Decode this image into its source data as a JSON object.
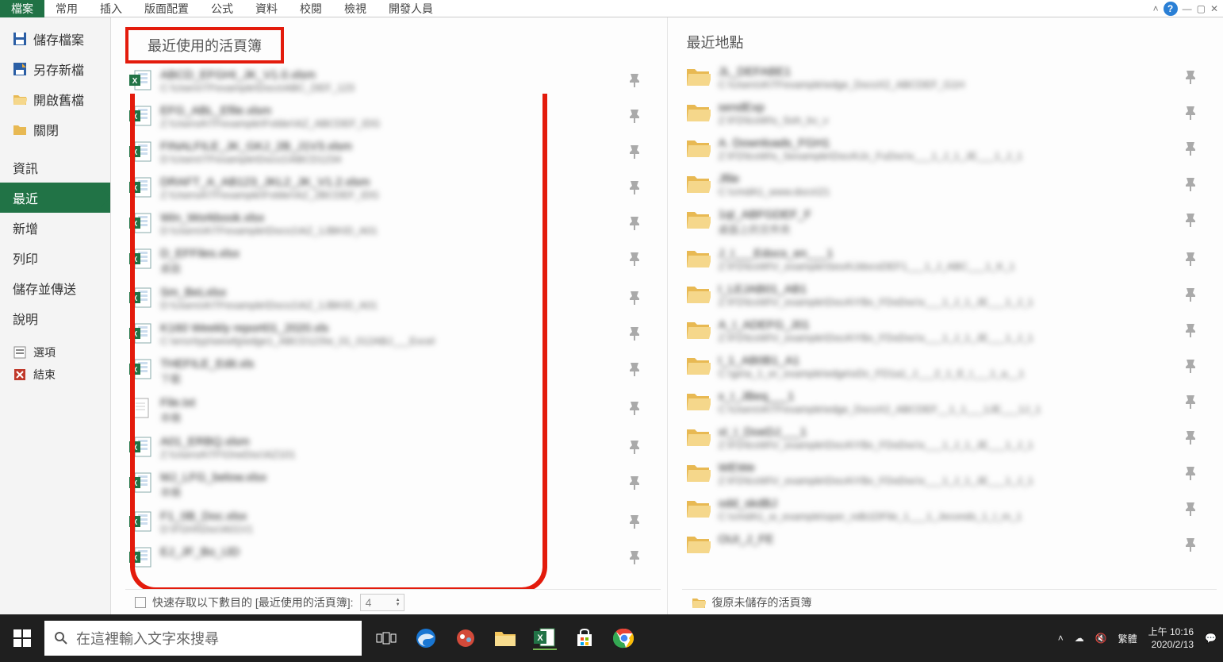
{
  "ribbon": {
    "tabs": [
      "檔案",
      "常用",
      "插入",
      "版面配置",
      "公式",
      "資料",
      "校閱",
      "檢視",
      "開發人員"
    ],
    "active_index": 0
  },
  "sidebar": {
    "items": [
      {
        "label": "儲存檔案",
        "icon": "save"
      },
      {
        "label": "另存新檔",
        "icon": "save-as"
      },
      {
        "label": "開啟舊檔",
        "icon": "open"
      },
      {
        "label": "關閉",
        "icon": "close-folder"
      }
    ],
    "items2": [
      {
        "label": "資訊"
      },
      {
        "label": "最近",
        "selected": true
      },
      {
        "label": "新增"
      },
      {
        "label": "列印"
      },
      {
        "label": "儲存並傳送"
      },
      {
        "label": "說明"
      }
    ],
    "items3": [
      {
        "label": "選項",
        "icon": "options"
      },
      {
        "label": "結束",
        "icon": "exit"
      }
    ]
  },
  "recent_workbooks": {
    "header": "最近使用的活頁簿",
    "items": [
      {
        "name": "ABCD_EFGHI_JK_V1.0.xlsm",
        "path": "C:\\Users\\TFexample\\Docs\\ABC_DEF_123"
      },
      {
        "name": "EFG_ABL_Efile.xlsm",
        "path": "Z:\\UsersA\\TFexample\\Folder\\AZ_ABCDEF_IDG"
      },
      {
        "name": "FINALFILE_JK_GKJ_2B_J1V3.xlsm",
        "path": "D:\\Users\\TFexample\\Docs1\\ABCD1234"
      },
      {
        "name": "DRAFT_A_AB123_JKL2_JK_V1.2.xlsm",
        "path": "Z:\\UsersA\\TFexample\\Folder\\AZ_2BCDEF_IDG"
      },
      {
        "name": "Win_Workbook.xlsx",
        "path": "D:\\Users\\A\\TFexample\\Docs1\\AZ_1JBKID_A01"
      },
      {
        "name": "D_EFFiles.xlsx",
        "path": "桌面"
      },
      {
        "name": "Sm_BeLxlsx",
        "path": "D:\\Users\\A\\TFexample\\Docs1\\AZ_1JBKID_A01"
      },
      {
        "name": "K160 Weekly report01_2020.xls",
        "path": "C:\\ersx\\typ\\wewfg\\edge1_ABCD123\\e_01_012ABJ___Excel"
      },
      {
        "name": "THEFILE_Edit.xls",
        "path": "下載"
      },
      {
        "name": "File.txt",
        "path": "本機",
        "txt": true
      },
      {
        "name": "A01_ERBQ.xlsm",
        "path": "Z:\\UsersA\\TF\\OneDoc\\AZ101"
      },
      {
        "name": "MJ_LFG_below.xlsx",
        "path": "本機"
      },
      {
        "name": "F1_0B_Doc.xlsx",
        "path": "D:\\FGHI\\Doc\\A01V1"
      },
      {
        "name": "EJ_JF_Bo_IJD",
        "path": ""
      }
    ]
  },
  "recent_places": {
    "header": "最近地點",
    "items": [
      {
        "name": "JL_DEFABE1",
        "path": "C:\\Users\\A\\TFexample\\edge_DocsX2_ABCDEF_G1H"
      },
      {
        "name": "sendExp",
        "path": "Z:\\FD\\lcsW\\s_Soh_kv_v"
      },
      {
        "name": "A. Downloads_FGH1",
        "path": "Z:\\FD\\lcsW\\s_Sexample\\DocA\\Jc_FuDoc\\x___1_J_1_JE___1_J_1"
      },
      {
        "name": "Jfile",
        "path": "C:\\cmdA1_www.docs\\21"
      },
      {
        "name": "1qI_ABFGDEF_F",
        "path": "桌面上的文件夾"
      },
      {
        "name": "J_I___Edocs_en___1",
        "path": "Z:\\FD\\lcsW\\V_example\\SexA\\JdocsDEF1___1_J_ABC___1_K_1"
      },
      {
        "name": "I_LEJAB01_AB1",
        "path": "Z:\\FD\\lcsW\\V_example\\DocA\\YBx_FDoDoc\\x___1_J_1_JE___1_J_1"
      },
      {
        "name": "A_I_ADEFG_J01",
        "path": "Z:\\FD\\lcsW\\V_example\\DocA\\YBx_FDoDoc\\x___1_J_1_JE___1_J_1"
      },
      {
        "name": "I_1_AB0B1_A1",
        "path": "C:\\ge\\a_1_er_example\\edge\\oDc_FD1a1_J___2_1_E_I___1_a__1"
      },
      {
        "name": "x_I_JBeq___1",
        "path": "C:\\Users\\A\\TFexample\\edge_DocsX2_ABCDEF__1_1___1JE___1J_1"
      },
      {
        "name": "xI_I_DoeDJ___1",
        "path": "Z:\\FD\\lcsW\\V_example\\DocA\\YBx_FDoDoc\\x___1_J_1_JE___1_J_1"
      },
      {
        "name": "WEWe",
        "path": "Z:\\FD\\lcsW\\V_example\\DocA\\YBx_FDoDoc\\x___1_J_1_JE___1_J_1"
      },
      {
        "name": "odd_skdBJ",
        "path": "C:\\cmdA1_w_example\\oper_ndb1DFile_1___1_Jeconds_1_I_m_1"
      },
      {
        "name": "OUI_J_FE",
        "path": ""
      }
    ]
  },
  "footer": {
    "quick_access_label": "快速存取以下數目的 [最近使用的活頁簿]:",
    "quick_access_value": "4",
    "recover_label": "復原未儲存的活頁簿"
  },
  "taskbar": {
    "search_placeholder": "在這裡輸入文字來搜尋",
    "ime_label": "繁體",
    "time": "上午 10:16",
    "date": "2020/2/13"
  }
}
